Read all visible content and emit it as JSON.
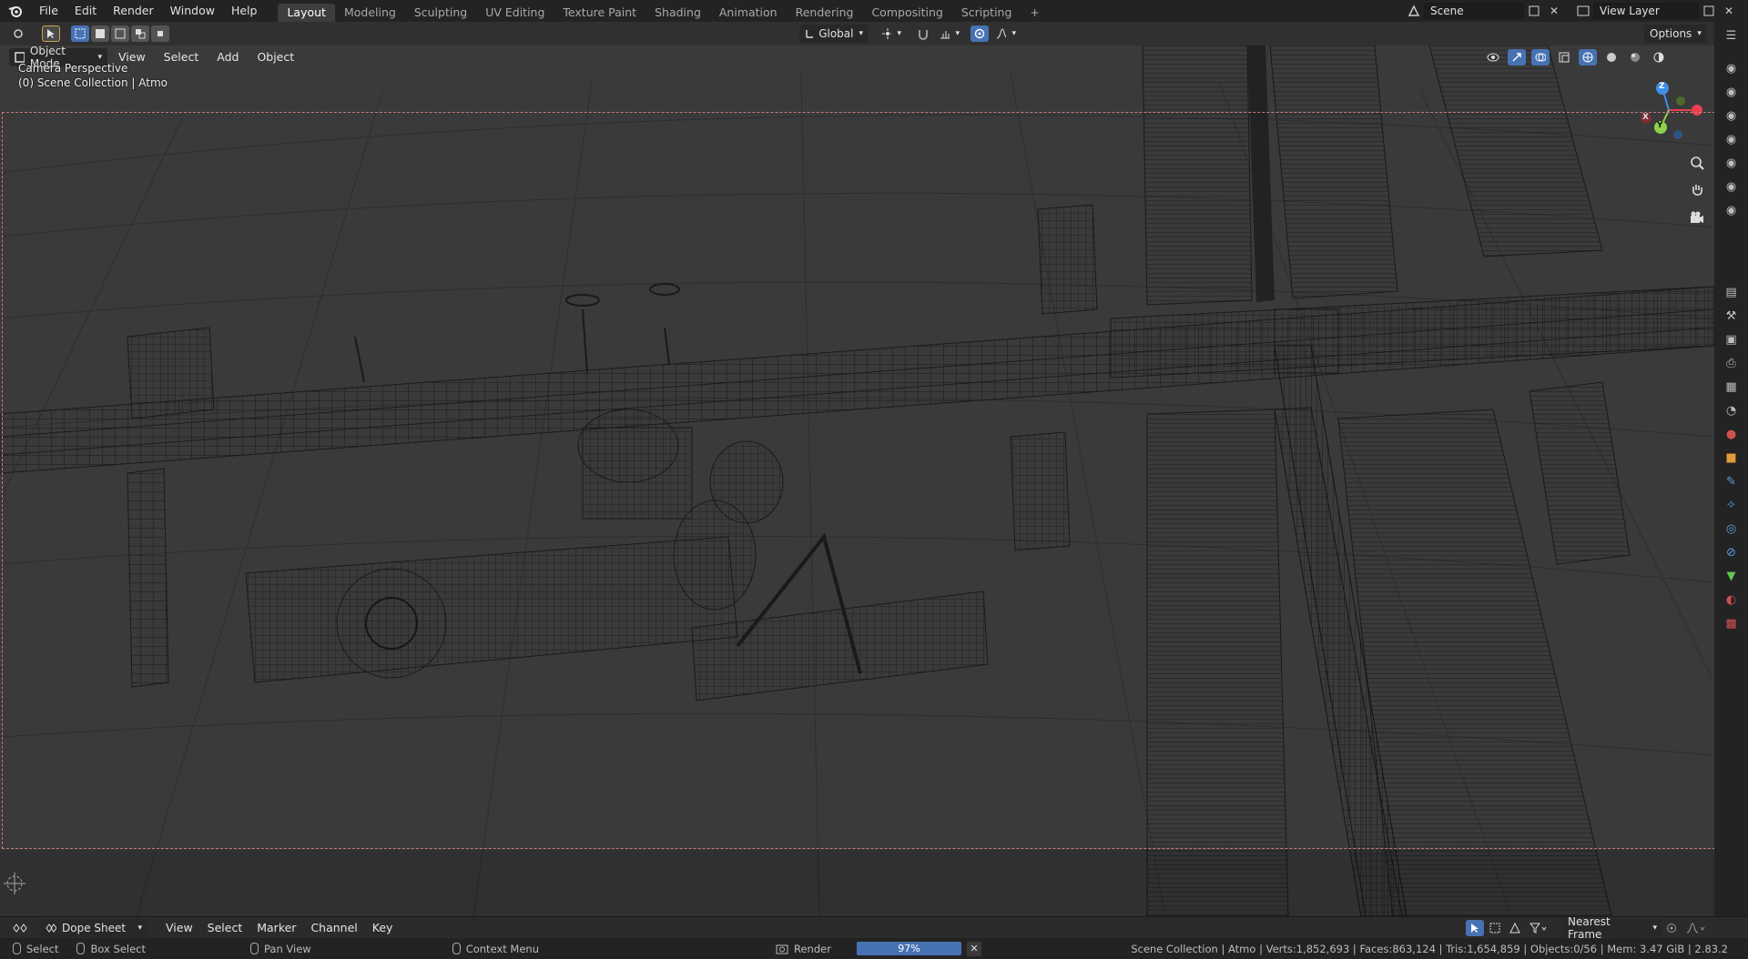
{
  "top_menu": {
    "items": [
      "File",
      "Edit",
      "Render",
      "Window",
      "Help"
    ],
    "workspaces": [
      "Layout",
      "Modeling",
      "Sculpting",
      "UV Editing",
      "Texture Paint",
      "Shading",
      "Animation",
      "Rendering",
      "Compositing",
      "Scripting"
    ],
    "active_workspace": "Layout",
    "add_tab": "+",
    "scene_name": "Scene",
    "view_layer": "View Layer"
  },
  "header": {
    "transform_orientation": "Global",
    "options_label": "Options"
  },
  "viewport": {
    "mode": "Object Mode",
    "menus": [
      "View",
      "Select",
      "Add",
      "Object"
    ],
    "view_name": "Camera Perspective",
    "collection_info": "(0) Scene Collection | Atmo",
    "gizmo_labels": {
      "z": "Z",
      "y": "Y",
      "x": "X"
    }
  },
  "dopesheet": {
    "editor": "Dope Sheet",
    "menus": [
      "View",
      "Select",
      "Marker",
      "Channel",
      "Key"
    ],
    "snap_mode": "Nearest Frame"
  },
  "statusbar": {
    "select": "Select",
    "box_select": "Box Select",
    "pan_view": "Pan View",
    "context_menu": "Context Menu",
    "render_label": "Render",
    "render_progress": "97%",
    "render_progress_value": 0.97,
    "scene_stats": "Scene Collection | Atmo | Verts:1,852,693 | Faces:863,124 | Tris:1,654,859 | Objects:0/56 | Mem: 3.47 GiB | 2.83.2"
  },
  "colors": {
    "accent_blue": "#4772b3",
    "camera_frame": "#c97a7a",
    "axis_x": "#e8404f",
    "axis_y": "#8bd14c",
    "axis_z": "#3f8ee8"
  }
}
